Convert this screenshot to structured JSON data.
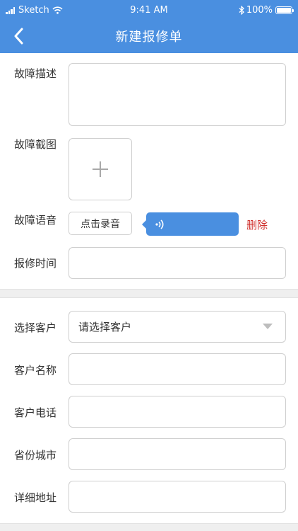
{
  "status_bar": {
    "carrier": "Sketch",
    "time": "9:41 AM",
    "battery": "100%"
  },
  "nav": {
    "title": "新建报修单",
    "back_icon": "chevron-left-icon"
  },
  "form": {
    "fault_description_label": "故障描述",
    "fault_description_value": "",
    "fault_screenshot_label": "故障截图",
    "fault_voice_label": "故障语音",
    "record_button_label": "点击录音",
    "delete_label": "删除",
    "report_time_label": "报修时间",
    "report_time_value": "",
    "select_customer_label": "选择客户",
    "select_customer_placeholder": "请选择客户",
    "customer_name_label": "客户名称",
    "customer_phone_label": "客户电话",
    "province_city_label": "省份城市",
    "address_label": "详细地址"
  },
  "colors": {
    "header": "#4a8fe0",
    "delete": "#d0312d"
  }
}
